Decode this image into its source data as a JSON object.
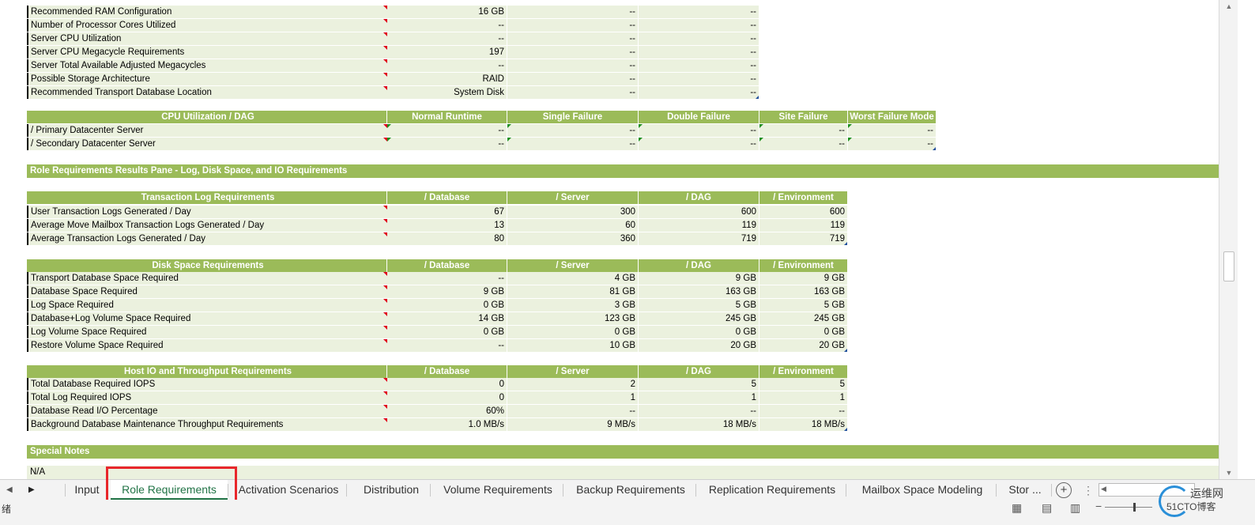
{
  "rows_top": [
    {
      "label": "Recommended RAM Configuration",
      "v": [
        "16 GB",
        "--",
        "--"
      ]
    },
    {
      "label": "Number of Processor Cores Utilized",
      "v": [
        "--",
        "--",
        "--"
      ]
    },
    {
      "label": "Server CPU Utilization",
      "v": [
        "--",
        "--",
        "--"
      ]
    },
    {
      "label": "Server CPU Megacycle Requirements",
      "v": [
        "197",
        "--",
        "--"
      ]
    },
    {
      "label": "Server Total Available Adjusted Megacycles",
      "v": [
        "--",
        "--",
        "--"
      ]
    },
    {
      "label": "Possible Storage Architecture",
      "v": [
        "RAID",
        "--",
        "--"
      ]
    },
    {
      "label": "Recommended Transport Database Location",
      "v": [
        "System Disk",
        "--",
        "--"
      ]
    }
  ],
  "cpu_table": {
    "headers": [
      "CPU Utilization / DAG",
      "Normal Runtime",
      "Single Failure",
      "Double Failure",
      "Site Failure",
      "Worst Failure Mode"
    ],
    "rows": [
      {
        "label": "/ Primary Datacenter Server",
        "v": [
          "--",
          "--",
          "--",
          "--",
          "--"
        ]
      },
      {
        "label": "/ Secondary Datacenter Server",
        "v": [
          "--",
          "--",
          "--",
          "--",
          "--"
        ]
      }
    ]
  },
  "section_band": "Role Requirements Results Pane  - Log, Disk Space, and IO Requirements",
  "log_table": {
    "headers": [
      "Transaction Log Requirements",
      "/ Database",
      "/ Server",
      "/ DAG",
      "/ Environment"
    ],
    "rows": [
      {
        "label": "User Transaction Logs Generated / Day",
        "v": [
          "67",
          "300",
          "600",
          "600"
        ]
      },
      {
        "label": "Average Move Mailbox Transaction Logs Generated / Day",
        "v": [
          "13",
          "60",
          "119",
          "119"
        ]
      },
      {
        "label": "Average Transaction Logs Generated / Day",
        "v": [
          "80",
          "360",
          "719",
          "719"
        ]
      }
    ]
  },
  "disk_table": {
    "headers": [
      "Disk Space Requirements",
      "/ Database",
      "/ Server",
      "/ DAG",
      "/ Environment"
    ],
    "rows": [
      {
        "label": "Transport Database Space Required",
        "v": [
          "--",
          "4 GB",
          "9 GB",
          "9 GB"
        ]
      },
      {
        "label": "Database Space Required",
        "v": [
          "9 GB",
          "81 GB",
          "163 GB",
          "163 GB"
        ]
      },
      {
        "label": "Log Space Required",
        "v": [
          "0 GB",
          "3 GB",
          "5 GB",
          "5 GB"
        ]
      },
      {
        "label": "Database+Log Volume Space Required",
        "v": [
          "14 GB",
          "123 GB",
          "245 GB",
          "245 GB"
        ]
      },
      {
        "label": "Log Volume Space Required",
        "v": [
          "0 GB",
          "0 GB",
          "0 GB",
          "0 GB"
        ]
      },
      {
        "label": "Restore Volume Space Required",
        "v": [
          "--",
          "10 GB",
          "20 GB",
          "20 GB"
        ]
      }
    ]
  },
  "io_table": {
    "headers": [
      "Host IO and Throughput Requirements",
      "/ Database",
      "/ Server",
      "/ DAG",
      "/ Environment"
    ],
    "rows": [
      {
        "label": "Total Database Required IOPS",
        "v": [
          "0",
          "2",
          "5",
          "5"
        ]
      },
      {
        "label": "Total Log Required IOPS",
        "v": [
          "0",
          "1",
          "1",
          "1"
        ]
      },
      {
        "label": "Database Read I/O Percentage",
        "v": [
          "60%",
          "--",
          "--",
          "--"
        ]
      },
      {
        "label": "Background Database Maintenance Throughput Requirements",
        "v": [
          "1.0 MB/s",
          "9 MB/s",
          "18 MB/s",
          "18 MB/s"
        ]
      }
    ]
  },
  "special_notes": {
    "title": "Special Notes",
    "text": "N/A"
  },
  "tabs": [
    {
      "label": "Input",
      "active": false
    },
    {
      "label": "Role Requirements",
      "active": true
    },
    {
      "label": "Activation Scenarios",
      "active": false
    },
    {
      "label": "Distribution",
      "active": false
    },
    {
      "label": "Volume Requirements",
      "active": false
    },
    {
      "label": "Backup Requirements",
      "active": false
    },
    {
      "label": "Replication Requirements",
      "active": false
    },
    {
      "label": "Mailbox Space Modeling",
      "active": false
    },
    {
      "label": "Stor ...",
      "active": false
    }
  ],
  "status": {
    "ready": "绪"
  },
  "watermark": {
    "line1": "运维网",
    "line2": "51CTO博客"
  },
  "colors": {
    "header_green": "#9bbb59",
    "row_fill": "#ebf1de",
    "active_tab": "#217346",
    "highlight_box": "#e8262b"
  }
}
